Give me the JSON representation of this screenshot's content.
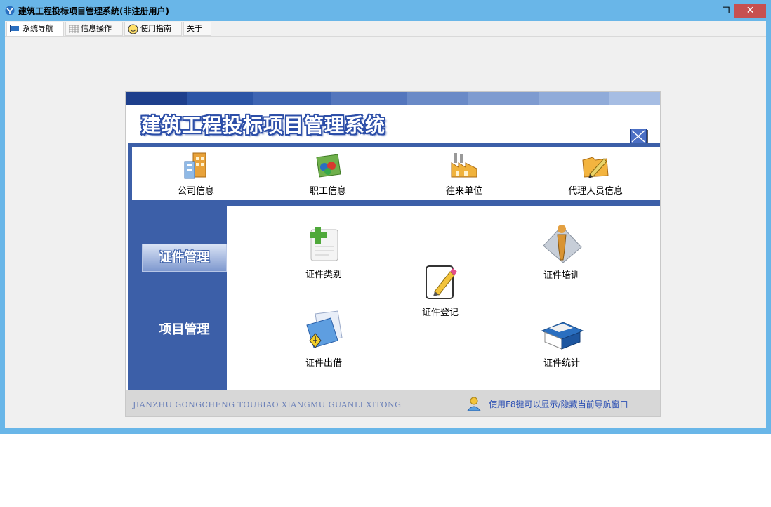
{
  "window": {
    "title": "建筑工程投标项目管理系统(非注册用户)",
    "min_glyph": "–",
    "max_glyph": "❐",
    "close_glyph": "✕"
  },
  "tabs": [
    {
      "label": "系统导航",
      "icon": "monitor-icon"
    },
    {
      "label": "信息操作",
      "icon": "grid-icon"
    },
    {
      "label": "使用指南",
      "icon": "smiley-icon"
    },
    {
      "label": "关于",
      "icon": ""
    }
  ],
  "nav": {
    "title": "建筑工程投标项目管理系统",
    "top_items": [
      {
        "label": "公司信息",
        "icon": "company-icon"
      },
      {
        "label": "职工信息",
        "icon": "staff-icon"
      },
      {
        "label": "往来单位",
        "icon": "factory-icon"
      },
      {
        "label": "代理人员信息",
        "icon": "agent-icon"
      }
    ],
    "side_items": [
      {
        "label": "证件管理",
        "active": true
      },
      {
        "label": "项目管理",
        "active": false
      }
    ],
    "main_items": [
      {
        "label": "证件类别",
        "icon": "add-document-icon"
      },
      {
        "label": "证件登记",
        "icon": "edit-document-icon"
      },
      {
        "label": "证件培训",
        "icon": "person-icon"
      },
      {
        "label": "证件出借",
        "icon": "folder-icon"
      },
      {
        "label": "证件统计",
        "icon": "book-icon"
      }
    ],
    "footer_pinyin": "JIANZHU GONGCHENG TOUBIAO XIANGMU GUANLI XITONG",
    "footer_tip": "使用F8键可以显示/隐藏当前导航窗口"
  },
  "colors": {
    "title_bar": "#69b6e8",
    "nav_blue": "#3c5fa8",
    "close_button": "#c75050",
    "tip_text": "#2f52b4"
  }
}
